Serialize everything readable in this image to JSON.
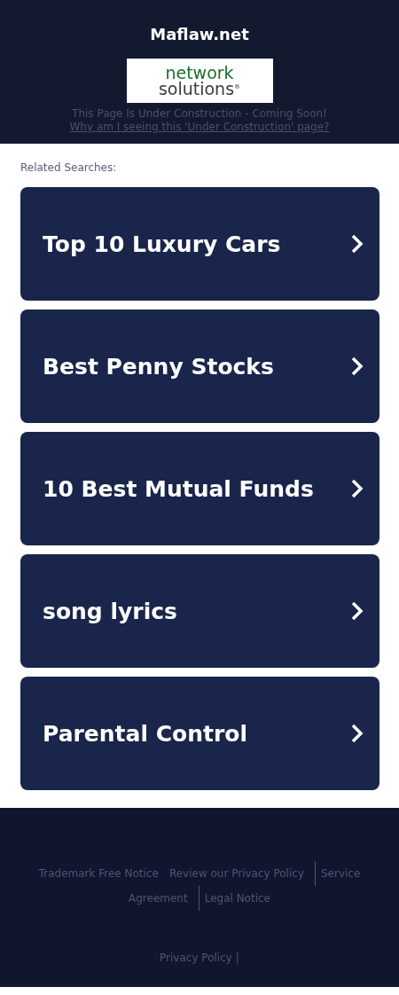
{
  "header": {
    "title": "Maflaw.net",
    "logo": {
      "line_1": "network",
      "line_2": "solutions",
      "mark": "®"
    },
    "notice": "This Page Is Under Construction - Coming Soon!",
    "link": "Why am I seeing this 'Under Construction' page?"
  },
  "related": {
    "heading": "Related Searches:",
    "items": [
      {
        "label": "Top 10 Luxury Cars"
      },
      {
        "label": "Best Penny Stocks"
      },
      {
        "label": "10 Best Mutual Funds"
      },
      {
        "label": "song lyrics"
      },
      {
        "label": "Parental Control"
      }
    ]
  },
  "footer": {
    "link_rows": [
      [
        {
          "label": "Trademark Free Notice",
          "divider_before": false
        },
        {
          "label": "Review our Privacy Policy",
          "divider_before": false
        },
        {
          "label": "Service",
          "divider_before": true
        }
      ],
      [
        {
          "label": "Agreement",
          "divider_before": false
        },
        {
          "label": "Legal Notice",
          "divider_before": true
        }
      ]
    ],
    "bottom_link": "Privacy Policy",
    "bottom_separator": "|"
  }
}
